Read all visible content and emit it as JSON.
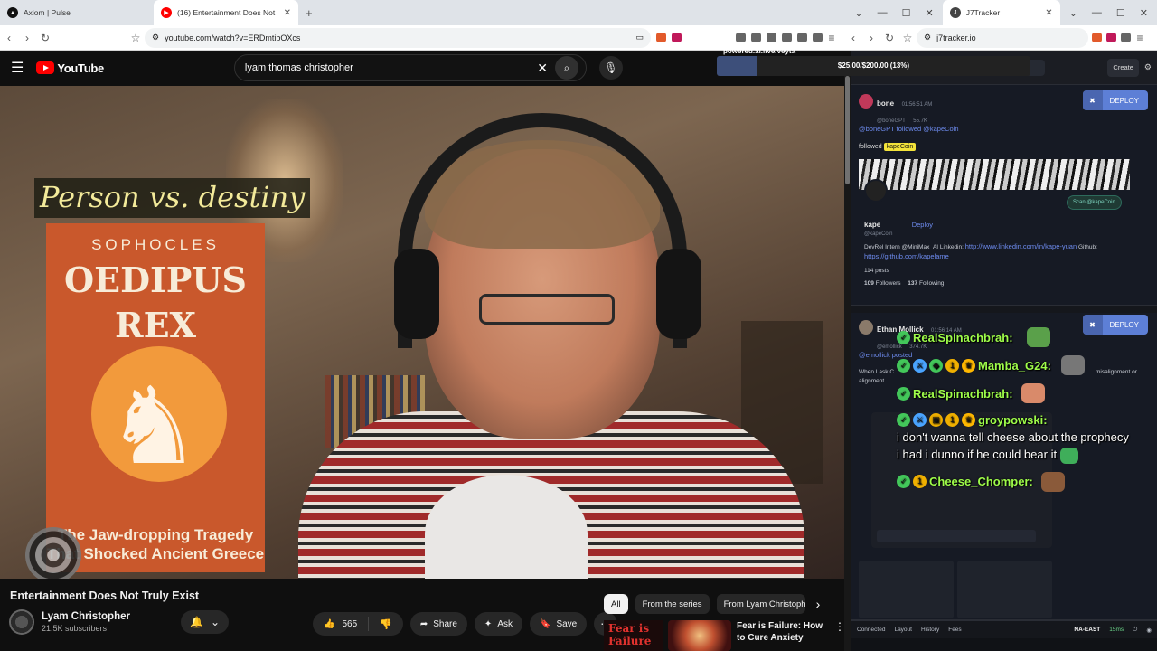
{
  "tabs": [
    {
      "title": "Axiom | Pulse",
      "active": false
    },
    {
      "title": "(16) Entertainment Does Not",
      "active": true
    },
    {
      "title": "J7Tracker",
      "active": false
    }
  ],
  "address": {
    "left_url": "youtube.com/watch?v=ERDmtibOXcs",
    "right_url": "j7tracker.io"
  },
  "youtube": {
    "logo": "YouTube",
    "search_value": "lyam thomas christopher",
    "video": {
      "overlay_caption": "Person vs. destiny",
      "book_author": "SOPHOCLES",
      "book_title_1": "OEDIPUS",
      "book_title_2": "REX",
      "book_tagline": "The Jaw-dropping Tragedy That Shocked Ancient Greece"
    },
    "title": "Entertainment Does Not Truly Exist",
    "channel": {
      "name": "Lyam Christopher",
      "subscribers": "21.5K subscribers"
    },
    "actions": {
      "likes": "565",
      "share": "Share",
      "ask": "Ask",
      "save": "Save"
    },
    "chips": [
      "All",
      "From the series",
      "From Lyam Christophe"
    ],
    "recommendation": {
      "thumb_text_1": "Fear is",
      "thumb_text_2": "Failure",
      "title": "Fear is Failure: How to Cure Anxiety"
    }
  },
  "tracker": {
    "create_label": "Create",
    "powered_by": "powered.ai.live/veyta",
    "budget": {
      "label": "$25.00/$200.00 (13%)",
      "fraction": 0.13
    },
    "card1": {
      "user": "bone",
      "handle": "@boneGPT",
      "time": "01:56:51 AM",
      "followers": "55.7K",
      "action_line": "@boneGPT followed @kapeCoin",
      "followed_label": "followed",
      "ticker": "kapeCoin",
      "profile_name": "kape",
      "profile_handle": "@kapeCoin",
      "profile_deploy": "Deploy",
      "scan_label": "Scan @kapeCoin",
      "bio_prefix": "DevRel Intern @MiniMax_AI Linkedin: ",
      "bio_link": "http://www.linkedin.com/in/kape-yuan",
      "bio_suffix": " Github:",
      "bio_link2": "https://github.com/kapelame",
      "posts": "114 posts",
      "followers_count": "109",
      "followers_word": "Followers",
      "following_count": "137",
      "following_word": "Following"
    },
    "card2": {
      "user": "Ethan Mollick",
      "handle": "@emollick",
      "time": "01:56:14 AM",
      "followers": "374.7K",
      "action_line": "@emollick posted",
      "text_start": "When I ask C",
      "text_mid": "misalignment or",
      "text_end": "alignment."
    },
    "deploy_label": "DEPLOY",
    "status": {
      "connected": "Connected",
      "layout": "Layout",
      "history": "History",
      "fees": "Fees",
      "region": "NA-EAST",
      "ping": "15ms"
    }
  },
  "chat": [
    {
      "name": "RealSpinachbrah:",
      "message": ""
    },
    {
      "name": "Mamba_G24:",
      "message": ""
    },
    {
      "name": "RealSpinachbrah:",
      "message": ""
    },
    {
      "name": "groypowski:",
      "message": "i don't wanna tell cheese about the prophecy i had i dunno if he could bear it"
    },
    {
      "name": "Cheese_Chomper:",
      "message": ""
    }
  ],
  "colors": {
    "youtube_red": "#ff0000",
    "chat_name": "#9efc4a",
    "deploy": "#5d7fd6",
    "ticker": "#f3e33a"
  }
}
